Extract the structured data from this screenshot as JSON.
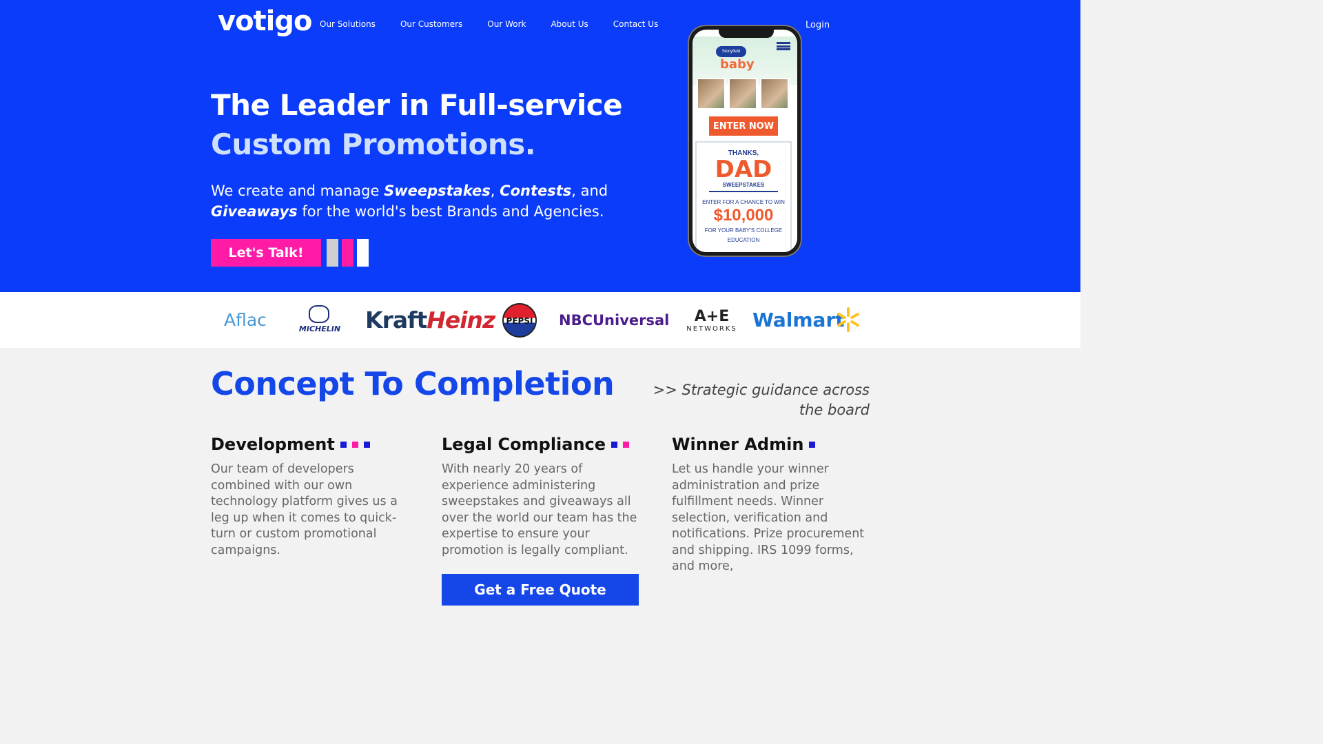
{
  "header": {
    "logo": "votigo",
    "nav": [
      "Our Solutions",
      "Our Customers",
      "Our Work",
      "About Us",
      "Contact Us"
    ],
    "login": "Login"
  },
  "hero": {
    "headline_line1": "The Leader in Full-service",
    "headline_line2": "Custom Promotions.",
    "sub_prefix": "We create and manage ",
    "sub_sweepstakes": "Sweepstakes",
    "sub_comma": ", ",
    "sub_contests": "Contests",
    "sub_and": ", and ",
    "sub_giveaways": "Giveaways",
    "sub_suffix": " for the world's best Brands and Agencies.",
    "cta": "Let's Talk!"
  },
  "phone": {
    "badge": "Stonyfield ORGANIC",
    "brand": "baby",
    "enter_button": "ENTER NOW",
    "thanks": "THANKS,",
    "dad": "DAD",
    "sweepstakes": "SWEEPSTAKES",
    "enter_chance": "ENTER FOR A CHANCE TO WIN",
    "amount": "$10,000",
    "college": "FOR YOUR BABY'S COLLEGE EDUCATION"
  },
  "clients": {
    "aflac": "Aflac",
    "michelin": "MICHELIN",
    "kraft": "Kraft",
    "heinz": "Heinz",
    "pepsi": "PEPSI",
    "nbcu": "NBCUniversal",
    "ae": "A+E",
    "ae_sub": "NETWORKS",
    "walmart": "Walmart"
  },
  "concept": {
    "title": "Concept To Completion",
    "tagline": ">> Strategic guidance across the board",
    "columns": [
      {
        "title": "Development",
        "text": "Our team of developers combined with our own technology platform gives us a leg up when it comes to quick-turn or custom promotional campaigns."
      },
      {
        "title": "Legal Compliance",
        "text": "With nearly 20 years of experience administering sweepstakes and giveaways all over the world our team has the expertise to ensure your promotion is legally compliant."
      },
      {
        "title": "Winner Admin",
        "text": "Let us handle your winner administration and prize fulfillment needs. Winner selection, verification and notifications. Prize procurement and shipping. IRS 1099 forms, and more,"
      }
    ],
    "quote_button": "Get a Free Quote"
  },
  "colors": {
    "hero_blue": "#0a3cfa",
    "accent_pink": "#ff1ba6",
    "title_blue": "#1446e8",
    "square_navy": "#1a1ad6"
  }
}
